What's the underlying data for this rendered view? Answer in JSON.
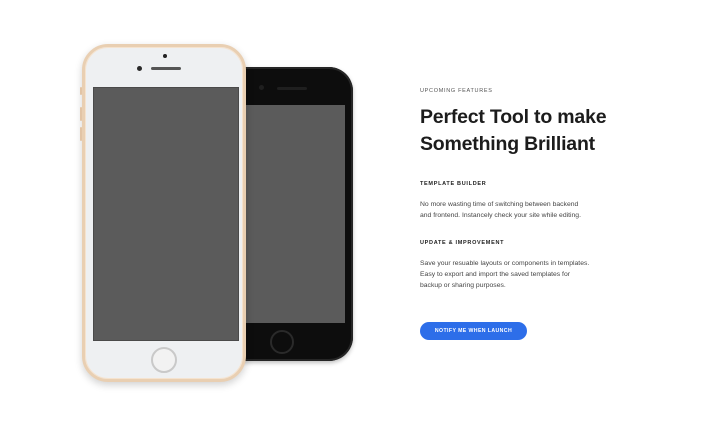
{
  "section": {
    "eyebrow": "UPCOMING FEATURES",
    "title_line1": "Perfect Tool to make",
    "title_line2": "Something Brilliant"
  },
  "features": [
    {
      "heading": "TEMPLATE BUILDER",
      "line1": "No more wasting time of switching between backend",
      "line2": "and frontend. Instancely check your site while editing."
    },
    {
      "heading": "UPDATE & IMPROVEMENT",
      "line1": "Save your resuable layouts or components in templates.",
      "line2": "Easy to export and import the saved templates for",
      "line3": "backup or sharing purposes."
    }
  ],
  "cta": {
    "label": "NOTIFY ME WHEN LAUNCH"
  },
  "colors": {
    "accent": "#2d6ee9",
    "heading": "#1c1c1c",
    "screen": "#5b5b5b",
    "phone_gold": "#e9cfb2",
    "phone_black": "#0d0d0d"
  },
  "icons": {
    "phone_black": "iphone-black-mockup",
    "phone_white": "iphone-white-gold-mockup"
  }
}
